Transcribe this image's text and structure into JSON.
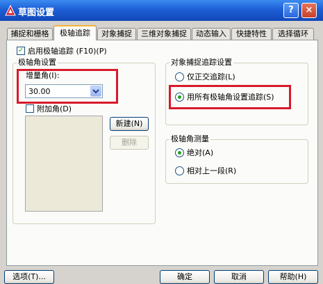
{
  "window": {
    "title": "草图设置",
    "help_glyph": "?",
    "close_glyph": "×",
    "colors": {
      "titlebar": "#1e5fd6",
      "highlight": "#d8192a",
      "check": "#21a121"
    }
  },
  "tabs": [
    {
      "label": "捕捉和栅格",
      "active": false
    },
    {
      "label": "极轴追踪",
      "active": true
    },
    {
      "label": "对象捕捉",
      "active": false
    },
    {
      "label": "三维对象捕捉",
      "active": false
    },
    {
      "label": "动态输入",
      "active": false
    },
    {
      "label": "快捷特性",
      "active": false
    },
    {
      "label": "选择循环",
      "active": false
    }
  ],
  "polar": {
    "enable_label": "启用极轴追踪 (F10)(P)",
    "enable_checked": true,
    "angle_group_label": "极轴角设置",
    "increment_label": "增量角(I):",
    "increment_value": "30.00",
    "additional_label": "附加角(D)",
    "additional_checked": false,
    "new_button": "新建(N)",
    "delete_button": "删除"
  },
  "object_snap_tracking": {
    "group_label": "对象捕捉追踪设置",
    "options": [
      {
        "label": "仅正交追踪(L)",
        "selected": false
      },
      {
        "label": "用所有极轴角设置追踪(S)",
        "selected": true
      }
    ]
  },
  "polar_measurement": {
    "group_label": "极轴角测量",
    "options": [
      {
        "label": "绝对(A)",
        "selected": true
      },
      {
        "label": "相对上一段(R)",
        "selected": false
      }
    ]
  },
  "footer": {
    "options_button": "选项(T)...",
    "ok_button": "确定",
    "cancel_button": "取消",
    "help_button": "帮助(H)"
  }
}
